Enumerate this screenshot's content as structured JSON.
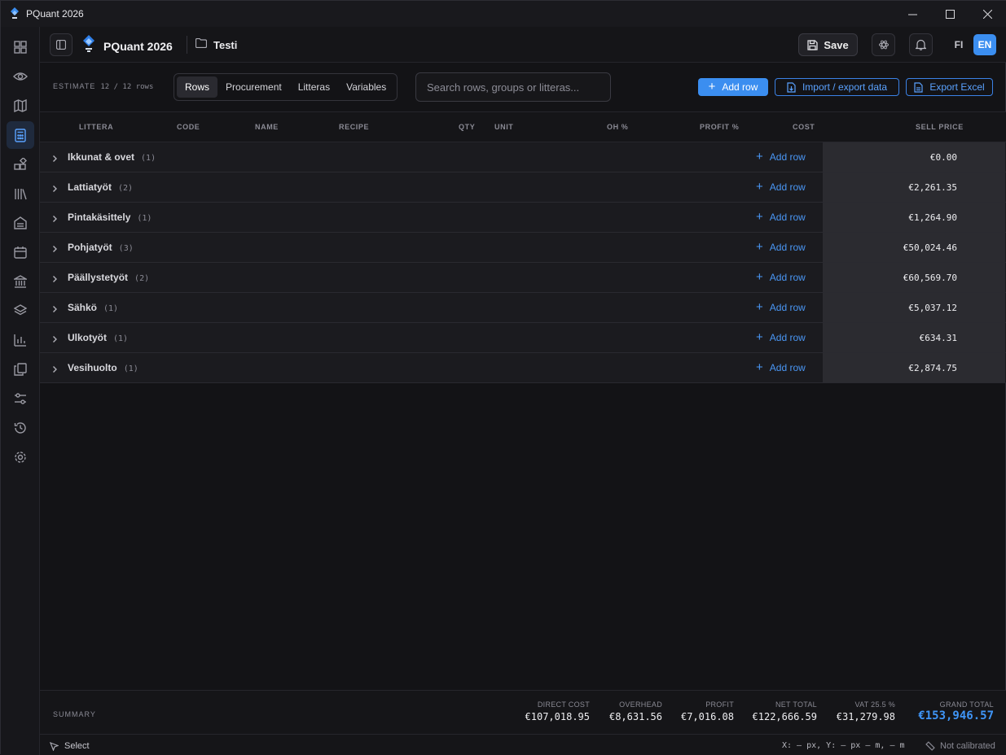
{
  "window": {
    "title": "PQuant 2026"
  },
  "appbar": {
    "brand": "PQuant 2026",
    "project": "Testi",
    "save_label": "Save",
    "lang_fi": "FI",
    "lang_en": "EN"
  },
  "toolbar": {
    "estimate_label": "ESTIMATE",
    "row_count": "12 / 12 rows",
    "tabs": [
      "Rows",
      "Procurement",
      "Litteras",
      "Variables"
    ],
    "active_tab": "Rows",
    "search_placeholder": "Search rows, groups or litteras...",
    "add_row_label": "Add row",
    "import_export_label": "Import / export data",
    "export_excel_label": "Export Excel"
  },
  "table": {
    "columns": [
      "LITTERA",
      "CODE",
      "NAME",
      "RECIPE",
      "QTY",
      "UNIT",
      "OH %",
      "PROFIT %",
      "COST",
      "SELL PRICE"
    ],
    "add_row_label": "Add row",
    "groups": [
      {
        "name": "Ikkunat & ovet",
        "count": "(1)",
        "sell_price": "€0.00"
      },
      {
        "name": "Lattiatyöt",
        "count": "(2)",
        "sell_price": "€2,261.35"
      },
      {
        "name": "Pintakäsittely",
        "count": "(1)",
        "sell_price": "€1,264.90"
      },
      {
        "name": "Pohjatyöt",
        "count": "(3)",
        "sell_price": "€50,024.46"
      },
      {
        "name": "Päällystetyöt",
        "count": "(2)",
        "sell_price": "€60,569.70"
      },
      {
        "name": "Sähkö",
        "count": "(1)",
        "sell_price": "€5,037.12"
      },
      {
        "name": "Ulkotyöt",
        "count": "(1)",
        "sell_price": "€634.31"
      },
      {
        "name": "Vesihuolto",
        "count": "(1)",
        "sell_price": "€2,874.75"
      }
    ]
  },
  "summary": {
    "label": "SUMMARY",
    "items": [
      {
        "label": "DIRECT COST",
        "value": "€107,018.95"
      },
      {
        "label": "OVERHEAD",
        "value": "€8,631.56"
      },
      {
        "label": "PROFIT",
        "value": "€7,016.08"
      },
      {
        "label": "NET TOTAL",
        "value": "€122,666.59"
      },
      {
        "label": "VAT 25.5 %",
        "value": "€31,279.98"
      },
      {
        "label": "GRAND TOTAL",
        "value": "€153,946.57"
      }
    ]
  },
  "status": {
    "tool": "Select",
    "coords": "X: — px, Y: — px — m, — m",
    "calibration": "Not calibrated"
  },
  "colors": {
    "accent": "#3b8ef0",
    "background": "#131316",
    "sell_cell": "#2b2b30"
  }
}
